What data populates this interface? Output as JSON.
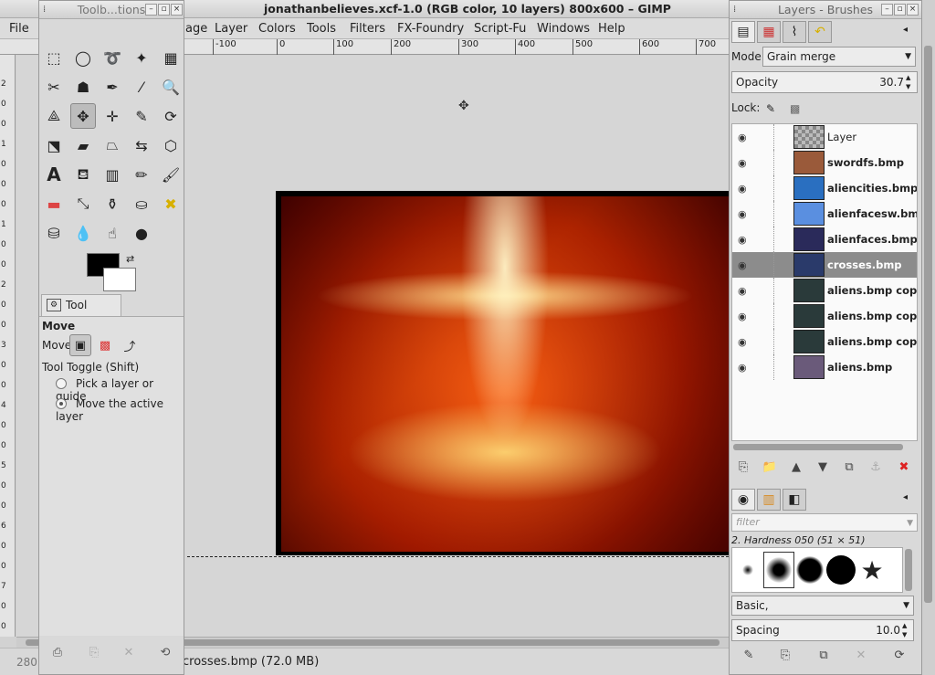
{
  "window": {
    "title": "jonathanbelieves.xcf-1.0 (RGB color, 10 layers) 800x600 – GIMP"
  },
  "menu": [
    "File",
    "age",
    "Layer",
    "Colors",
    "Tools",
    "Filters",
    "FX-Foundry",
    "Script-Fu",
    "Windows",
    "Help"
  ],
  "ruler": {
    "h_ticks": [
      "-100",
      "0",
      "100",
      "200",
      "300",
      "400",
      "500",
      "600",
      "700"
    ],
    "v_ticks": [
      "2",
      "0",
      "0",
      "1",
      "0",
      "0",
      "0",
      "1",
      "0",
      "0",
      "2",
      "0",
      "0",
      "3",
      "0",
      "0",
      "4",
      "0",
      "0",
      "5",
      "0",
      "0",
      "6",
      "0",
      "0",
      "7",
      "0",
      "0"
    ]
  },
  "status": {
    "coords": "280.",
    "message": "crosses.bmp (72.0 MB)"
  },
  "toolbox": {
    "title": "Toolb...tions",
    "tool_options_tab": "Tool Options",
    "tool_name": "Move",
    "move_label": "Move:",
    "toggle_label": "Tool Toggle  (Shift)",
    "option_pick": "Pick a layer or guide",
    "option_move": "Move the active layer"
  },
  "layers_dock": {
    "title": "Layers - Brushes",
    "mode_label": "Mode:",
    "mode_value": "Grain merge",
    "opacity_label": "Opacity",
    "opacity_value": "30.7",
    "lock_label": "Lock:",
    "layers": [
      {
        "name": "Layer",
        "selected": false,
        "thumb": "checker"
      },
      {
        "name": "swordfs.bmp",
        "selected": false,
        "thumb": "#9a5a3a"
      },
      {
        "name": "aliencities.bmp co",
        "selected": false,
        "thumb": "#2a6fc0"
      },
      {
        "name": "alienfacesw.bmp",
        "selected": false,
        "thumb": "#5a8fe0"
      },
      {
        "name": "alienfaces.bmp",
        "selected": false,
        "thumb": "#2a2a5a"
      },
      {
        "name": "crosses.bmp",
        "selected": true,
        "thumb": "#2a3a6a"
      },
      {
        "name": "aliens.bmp copy #",
        "selected": false,
        "thumb": "#2a3a3a"
      },
      {
        "name": "aliens.bmp copy #",
        "selected": false,
        "thumb": "#2a3a3a"
      },
      {
        "name": "aliens.bmp copy",
        "selected": false,
        "thumb": "#2a3a3a"
      },
      {
        "name": "aliens.bmp",
        "selected": false,
        "thumb": "#6a5a7a"
      }
    ],
    "brush_filter_placeholder": "filter",
    "brush_name": "2. Hardness 050 (51 × 51)",
    "brush_set": "Basic,",
    "spacing_label": "Spacing",
    "spacing_value": "10.0"
  }
}
